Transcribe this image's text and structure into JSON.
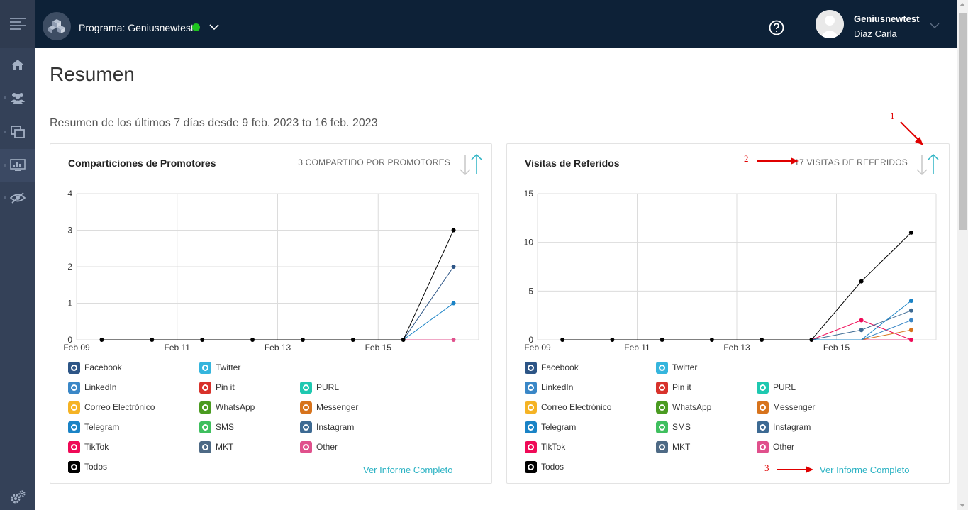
{
  "header": {
    "program_label": "Programa: Geniusnewtest",
    "user_name": "Geniusnewtest",
    "user_sub": "Diaz Carla"
  },
  "main": {
    "title": "Resumen",
    "summary": "Resumen de los últimos 7 días desde 9 feb. 2023 to 16 feb. 2023"
  },
  "cards": [
    {
      "title": "Comparticiones de Promotores",
      "count": "3 COMPARTIDO POR PROMOTORES",
      "report_link": "Ver Informe Completo"
    },
    {
      "title": "Visitas de Referidos",
      "count": "17 VISITAS DE REFERIDOS",
      "report_link": "Ver Informe Completo"
    }
  ],
  "legend": [
    {
      "label": "Facebook",
      "color": "#2d5586"
    },
    {
      "label": "Twitter",
      "color": "#35b5dd"
    },
    {
      "label": "LinkedIn",
      "color": "#3a87c7"
    },
    {
      "label": "Pin it",
      "color": "#d8322b"
    },
    {
      "label": "PURL",
      "color": "#1ec8b0"
    },
    {
      "label": "Correo Electrónico",
      "color": "#f5b324"
    },
    {
      "label": "WhatsApp",
      "color": "#4a9b21"
    },
    {
      "label": "Messenger",
      "color": "#d7731c"
    },
    {
      "label": "Telegram",
      "color": "#1a83c6"
    },
    {
      "label": "SMS",
      "color": "#3fbf5e"
    },
    {
      "label": "Instagram",
      "color": "#3d6a93"
    },
    {
      "label": "TikTok",
      "color": "#ef0a57"
    },
    {
      "label": "MKT",
      "color": "#4e6a85"
    },
    {
      "label": "Other",
      "color": "#e0508c"
    },
    {
      "label": "Todos",
      "color": "#000000"
    }
  ],
  "annotations": [
    "1",
    "2",
    "3"
  ],
  "chart_data": [
    {
      "type": "line",
      "title": "Comparticiones de Promotores",
      "x": [
        "Feb 09",
        "Feb 10",
        "Feb 11",
        "Feb 12",
        "Feb 13",
        "Feb 14",
        "Feb 15",
        "Feb 16"
      ],
      "xticks": [
        "Feb 09",
        "Feb 11",
        "Feb 13",
        "Feb 15"
      ],
      "ylim": [
        0,
        4
      ],
      "yticks": [
        0,
        1,
        2,
        3,
        4
      ],
      "grid": true,
      "series": [
        {
          "name": "Todos",
          "color": "#000000",
          "values": [
            0,
            0,
            0,
            0,
            0,
            0,
            0,
            3
          ]
        },
        {
          "name": "Facebook",
          "color": "#2d5586",
          "values": [
            0,
            0,
            0,
            0,
            0,
            0,
            0,
            2
          ]
        },
        {
          "name": "Telegram",
          "color": "#1a83c6",
          "values": [
            0,
            0,
            0,
            0,
            0,
            0,
            0,
            1
          ]
        },
        {
          "name": "Other",
          "color": "#e0508c",
          "values": [
            0,
            0,
            0,
            0,
            0,
            0,
            0,
            0
          ]
        }
      ]
    },
    {
      "type": "line",
      "title": "Visitas de Referidos",
      "x": [
        "Feb 09",
        "Feb 10",
        "Feb 11",
        "Feb 12",
        "Feb 13",
        "Feb 14",
        "Feb 15",
        "Feb 16"
      ],
      "xticks": [
        "Feb 09",
        "Feb 11",
        "Feb 13",
        "Feb 15"
      ],
      "ylim": [
        0,
        15
      ],
      "yticks": [
        0,
        5,
        10,
        15
      ],
      "grid": true,
      "series": [
        {
          "name": "Todos",
          "color": "#000000",
          "values": [
            0,
            0,
            0,
            0,
            0,
            0,
            6,
            11
          ]
        },
        {
          "name": "Telegram",
          "color": "#1a83c6",
          "values": [
            0,
            0,
            0,
            0,
            0,
            0,
            0,
            4
          ]
        },
        {
          "name": "Instagram",
          "color": "#3d6a93",
          "values": [
            0,
            0,
            0,
            0,
            0,
            0,
            1,
            3
          ]
        },
        {
          "name": "LinkedIn",
          "color": "#3a87c7",
          "values": [
            0,
            0,
            0,
            0,
            0,
            0,
            0,
            2
          ]
        },
        {
          "name": "Messenger",
          "color": "#d7731c",
          "values": [
            0,
            0,
            0,
            0,
            0,
            0,
            0,
            1
          ]
        },
        {
          "name": "TikTok",
          "color": "#ef0a57",
          "values": [
            0,
            0,
            0,
            0,
            0,
            0,
            2,
            0
          ]
        },
        {
          "name": "Other",
          "color": "#e0508c",
          "values": [
            0,
            0,
            0,
            0,
            0,
            0,
            0,
            0
          ]
        }
      ]
    }
  ]
}
